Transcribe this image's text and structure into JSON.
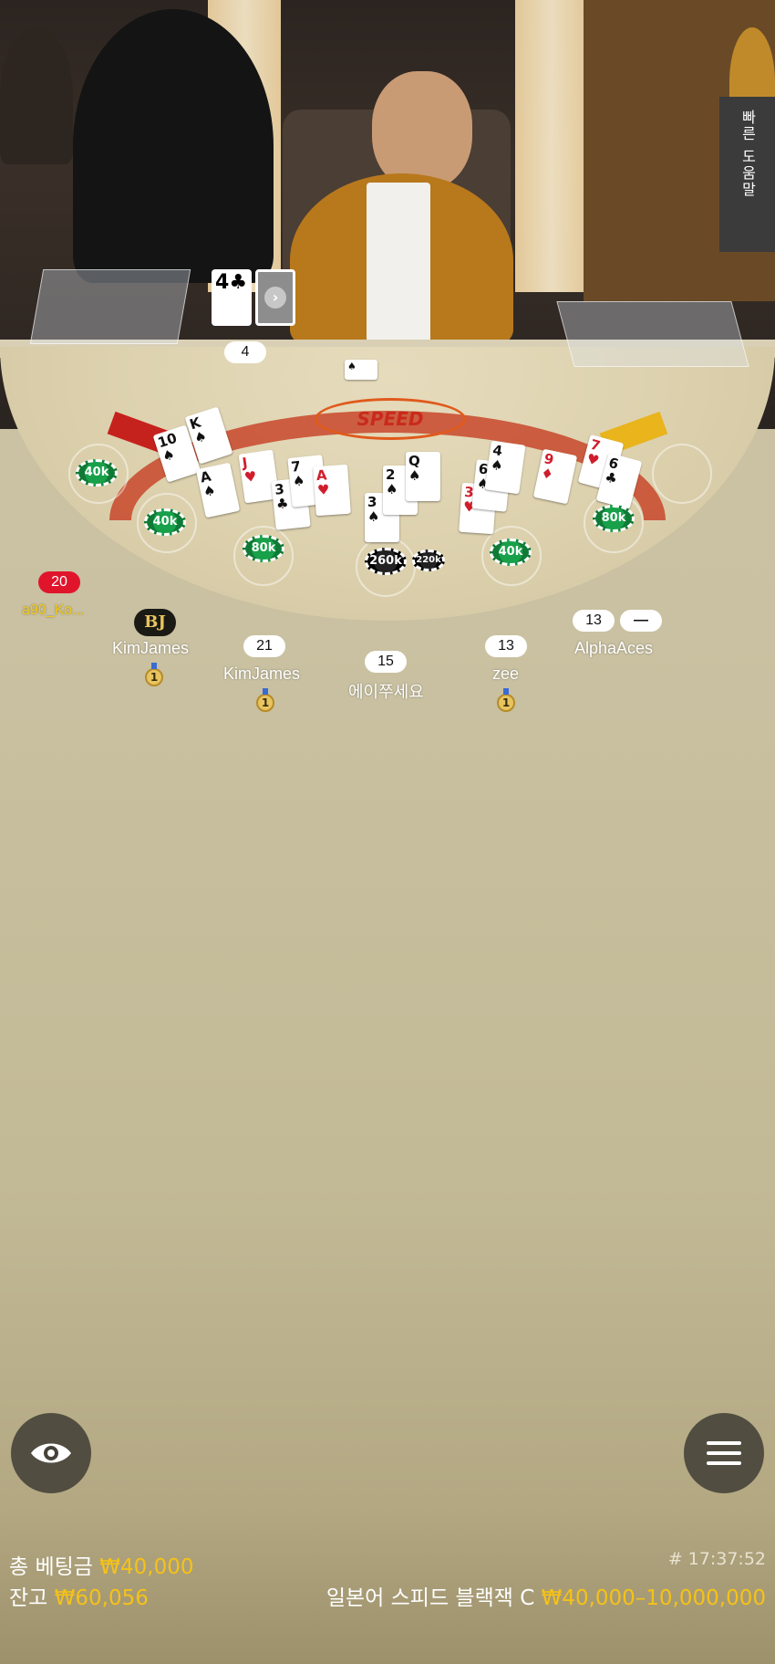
{
  "help": {
    "label": "빠른 도움말"
  },
  "dealer": {
    "card_rank": "4",
    "card_suit": "♣",
    "total": "4"
  },
  "table": {
    "logo": "SPEED"
  },
  "chips": [
    "40k",
    "40k",
    "80k",
    "260k",
    "220k",
    "40k",
    "80k"
  ],
  "players": [
    {
      "score": "20",
      "name": "a90_Ko..."
    },
    {
      "badge": "BJ",
      "name": "KimJames",
      "medal": "1"
    },
    {
      "score": "21",
      "name": "KimJames",
      "medal": "1"
    },
    {
      "score": "15",
      "name": "에이쭈세요"
    },
    {
      "score": "13",
      "name": "zee",
      "medal": "1"
    },
    {
      "score": "13",
      "extra": "—",
      "name": "AlphaAces"
    }
  ],
  "footer": {
    "total_bet_label": "총 베팅금",
    "total_bet_value": "₩40,000",
    "balance_label": "잔고",
    "balance_value": "₩60,056",
    "time": "# 17:37:52",
    "table_name": "일본어 스피드 블랙잭 C",
    "limits": "₩40,000–10,000,000"
  },
  "icons": {
    "view": "eye-icon",
    "menu": "hamburger-menu-icon"
  }
}
